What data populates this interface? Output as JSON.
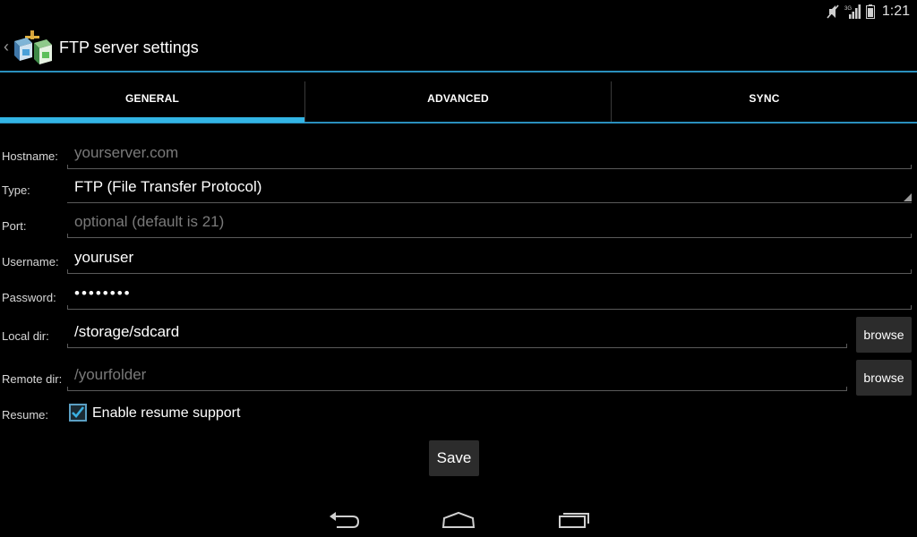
{
  "status_bar": {
    "time": "1:21",
    "network": "3G"
  },
  "action_bar": {
    "title": "FTP server settings",
    "back_glyph": "‹"
  },
  "tabs": [
    {
      "label": "GENERAL",
      "selected": true
    },
    {
      "label": "ADVANCED",
      "selected": false
    },
    {
      "label": "SYNC",
      "selected": false
    }
  ],
  "form": {
    "hostname": {
      "label": "Hostname:",
      "value": "",
      "placeholder": "yourserver.com"
    },
    "type": {
      "label": "Type:",
      "value": "FTP (File Transfer Protocol)"
    },
    "port": {
      "label": "Port:",
      "value": "",
      "placeholder": "optional (default is 21)"
    },
    "username": {
      "label": "Username:",
      "value": "youruser"
    },
    "password": {
      "label": "Password:",
      "value": "••••••••"
    },
    "local_dir": {
      "label": "Local dir:",
      "value": "/storage/sdcard",
      "browse_label": "browse"
    },
    "remote_dir": {
      "label": "Remote dir:",
      "value": "",
      "placeholder": "/yourfolder",
      "browse_label": "browse"
    },
    "resume": {
      "label": "Resume:",
      "checkbox_label": "Enable resume support",
      "checked": true
    }
  },
  "save_label": "Save",
  "colors": {
    "accent": "#33b5e5",
    "divider": "#2a8fbd",
    "background": "#000000",
    "button": "#2c2c2c"
  },
  "icons": {
    "status": [
      "mute-icon",
      "signal-icon",
      "battery-icon"
    ],
    "nav": [
      "back-icon",
      "home-icon",
      "recent-apps-icon"
    ],
    "app": "ftp-sync-app-icon"
  }
}
